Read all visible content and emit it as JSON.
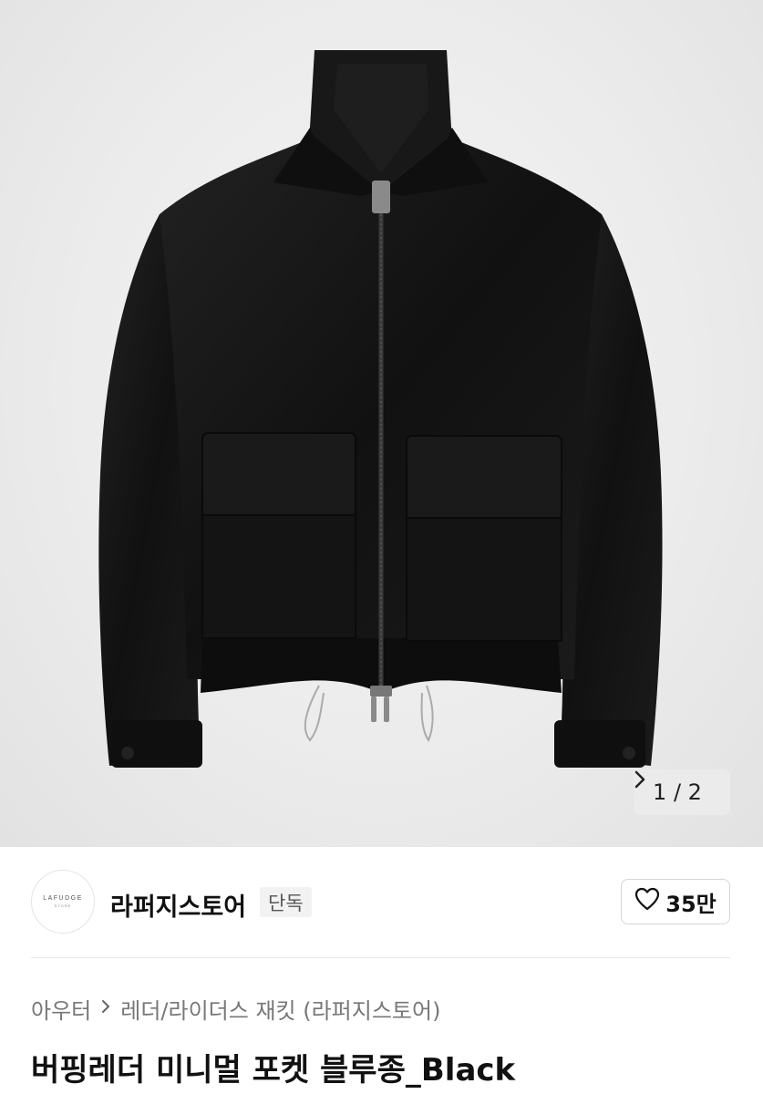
{
  "gallery": {
    "counter_text": "1 / 2",
    "next_icon": "chevron-right-icon",
    "image_subject": "jacket"
  },
  "store": {
    "logo_text": "LAFUDGE",
    "logo_subtext": "STORE",
    "name": "라퍼지스토어",
    "badge": "단독",
    "like_icon": "heart-outline-icon",
    "like_count": "35만"
  },
  "product": {
    "breadcrumb": [
      "아우터",
      "레더/라이더스 재킷 (라퍼지스토어)"
    ],
    "title": "버핑레더 미니멀 포켓 블루종_Black"
  },
  "colors": {
    "hero_background": "#ececec",
    "jacket": "#141414",
    "badge_background": "#f2f2f2",
    "breadcrumb_text": "#777777"
  }
}
